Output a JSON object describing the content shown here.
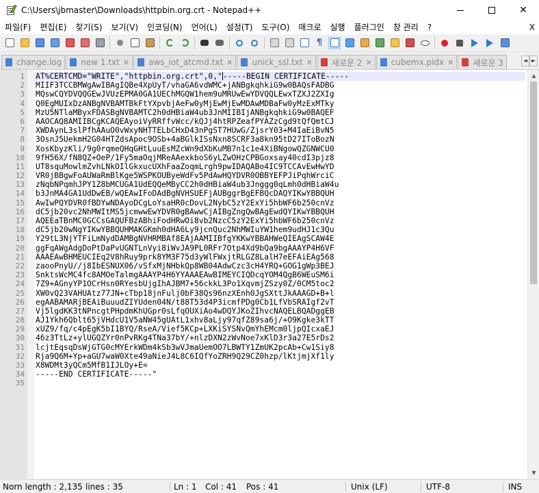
{
  "window": {
    "title": "C:\\Users\\jbmaster\\Downloads\\httpbin.org.crt - Notepad++",
    "minimize_glyph": "—",
    "maximize_glyph": "☐",
    "close_glyph": "✕"
  },
  "menu": {
    "items": [
      "파일(F)",
      "편집(E)",
      "찾기(S)",
      "보기(V)",
      "인코딩(N)",
      "언어(L)",
      "설정(T)",
      "도구(O)",
      "매크로",
      "실행",
      "플러그인",
      "창 관리",
      "?"
    ],
    "close_label": "X"
  },
  "tabs": [
    {
      "label": "change.log",
      "close": "✕",
      "active": false
    },
    {
      "label": "new 1.txt",
      "close": "✕",
      "active": false
    },
    {
      "label": "aws_iot_atcmd.txt",
      "close": "✕",
      "active": false
    },
    {
      "label": "unick_ssl.txt",
      "close": "✕",
      "active": false
    },
    {
      "label": "새로운 2",
      "close": "✕",
      "active": false
    },
    {
      "label": "cubemx.pidx",
      "close": "✕",
      "active": false
    },
    {
      "label": "새로운 3",
      "close": "✕",
      "active": false
    }
  ],
  "tab_arrows": {
    "left": "◄",
    "right": "►"
  },
  "editor": {
    "line_numbers": [
      "1",
      "2",
      "3",
      "4",
      "5",
      "6",
      "7",
      "8",
      "9",
      "10",
      "11",
      "12",
      "13",
      "14",
      "15",
      "16",
      "17",
      "18",
      "19",
      "20",
      "21",
      "22",
      "23",
      "24",
      "25",
      "26",
      "27",
      "28",
      "29",
      "30",
      "31",
      "32",
      "33",
      "34",
      "35"
    ],
    "lines": [
      "AT%CERTCMD=\"WRITE\",\"httpbin.org.crt\",0,\"-----BEGIN CERTIFICATE-----",
      "MIIF3TCCBMWgAwIBAgIQBe4XpUyT/vhaGA6vdWMC+jANBgkqhkiG9w0BAQsFADBG",
      "MQswCQYDVQQGEwJVUzEPMA0GA1UEChMGQW1hem9uMRUwEwYDVQQLEwxTZXJ2ZXIg",
      "Q0EgMUIxDzANBgNVBAMTBkFtYXpvbjAeFw0yMjEwMjEwMDAwMDBaFw0yMzExMTky",
      "MzU5NTlaMByxFDASBgNVBAMTC2h0dHBiaW4ub3JnMIIBIjANBgkqhkiG9w0BAQEF",
      "AAOCAQ8AMIIBCgKCAQEAyoiVyRRffvWcc/kQJj4htRPZeafPYAZzCgd9tQfQmtCJ",
      "XWDAynL3slPfhAAuO0vWxyNHTTELbCHxD43nPgST7HUwG/ZjsrY03+M4IaEiBvN5",
      "3OsnJ5UekmH2G04HTZdsApoc9OSb+4aBGlkISsNxn8SCRF3a8kn95tD27IToBozN",
      "XosKbyzKli/9g0rqmeQHqGHtLuuEsMZcWn9dXbKuMB7n1c1e4XiBNgowQZGNWCU0",
      "9fH56X/fN8QZ+OeP/1Fy5maOqjMReAAexkboS6yLZwOHzCPBGoxsay40cdI3pjz8",
      "UT8squMowlmZvhLNkOIlGkxucUXhFaaZoqmLrgh9pwIDAQABo4IC9TCCAvEwHwYD",
      "VR0jBBgwFoAUWaRmBlKge5WSPKOUByeWdFv5PdAwHQYDVR0OBBYEFPJiPqhWrciC",
      "zNqbNPqmhJPY1Z8bMCUGA1UdEQQeMByCC2h0dHBiaW4ub3Jnggg0qLmh0dHBiaW4u",
      "b3JnMA4GA1UdDwEB/wQEAwIFoDAdBgNVHSUEFjAUBggrBgEFBQcDAQYIKwYBBQUH",
      "AwIwPQYDVR0fBDYwNDAyoDCgLoYsaHR0cDovL2NybC5zY2ExYi5hbWF6b250cnVz",
      "dC5jb20vc2NhMWItMS5jcmwwEwYDVR0gBAwwCjAIBgZngQwBAgEwdQYIKwYBBQUH",
      "AQEEaTBnMC0GCCsGAQUFBzABhiFodHRwOi8vb2NzcC5zY2ExYi5hbWF6b250cnVz",
      "dC5jb20wNgYIKwYBBQUHMAKGKmh0dHA6Ly9jcnQuc2NhMWIuYW1hem9udHJ1c3Qu",
      "Y29tL3NjYTFiLmNydDAMBgNVHRMBAf8EAjAAMIIBfgYKKwYBBAHWeQIEAgSCAW4E",
      "ggFqAWgAdgDoPtDaPvUGNTLnVyi8iWvJA9PL0RFr7Otp4Xd9bQa9bgAAAYP4H6VF",
      "AAAEAwBHMEUCIEq2V8hRuy9prk8YM3F75d3yWlFWxjtRLGZ8LalH7eEFAiEAg568",
      "zaooPnyU//j8IbESNUX06/vSfxMjNHbkQp8WB04AdwCzc3cH4YRQ+GOG1gWp3BEJ",
      "SnktsWcMC4fc8AMOeTalmgAAAYP4H6YYAAAEAwBIMEYCIQDcqYOM4QgB6WEuSM6i",
      "7Z9+AGnyYP1OCrHsn0RYesbUjgIhAJBM7+56ckkL3Po1XqvmjZSzy0Z/0CM5toc2",
      "XW0vQ23VAHUAtz77JN+cTbp18jnFulj0bF38Qs96nzXEnh0JgSXttJkAAAGD+B+l",
      "egAABAMARjBEAiBuuudZIYUden04N/t88T53d4P3icmfPDg0Cb1LfVbSRAIgf2vT",
      "Vj5lgdKK3tNPncgtPHpdmKhUGpr0sLfqOUXiAo4wDQYJKoZIhvcNAQELBQADggEB",
      "AJ1Ykh6Qblt65jVHdcU1V5aNW45gUAtL1xhv8aLjy97qfZ89sa6j/+O9Kgke3kTT",
      "xUZ9/fq/c4pEgK5bI1BYQ/RseA/Vief5KCp+LXKiSYSNvQmYhEMcm0ljpQIcxaEJ",
      "46z3TtLz+ylUGQZYr0nPvRKg4TNa37bY/+nlzDXN2zWvNoe7xKlD3r3a27E5rDs2",
      "lcjtEqsqDsWjGTG0cMYErkWDm4kSb3wVJmaUemOO7LBWTY1ZmUK2pcAb+Cw1Siy8",
      "Rja9Q6M+Yp+aGU7waW0Xte49aNieJ4L8C6IQfYoZRH9Q29CZ0hzp/lKtjmjXf1ly",
      "X8WDMt3yQCm5MfB1IJLOy+E=",
      "-----END CERTIFICATE-----\"",
      ""
    ]
  },
  "scrollbar": {
    "up": "▲",
    "down": "▼"
  },
  "status": {
    "length": "Norn length : 2,135",
    "lines": "lines : 35",
    "ln": "Ln : 1",
    "col": "Col : 41",
    "pos": "Pos : 41",
    "eol": "Unix (LF)",
    "encoding": "UTF-8",
    "mode": "INS"
  },
  "colors": {
    "tab_active_accent": "#f5a623",
    "current_line": "#e8e8ff",
    "gutter": "#e4e4e4"
  }
}
